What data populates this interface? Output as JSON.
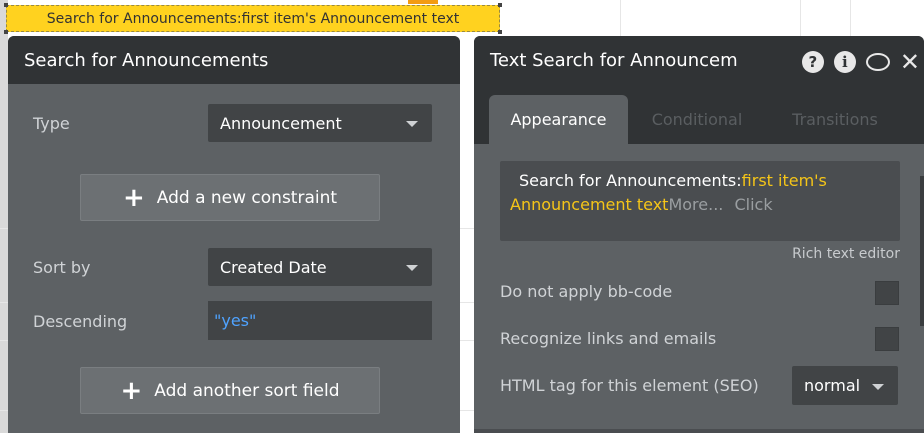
{
  "canvas": {
    "selected_text": "Search for Announcements:first item's Announcement text"
  },
  "left_panel": {
    "title": "Search for Announcements",
    "type_label": "Type",
    "type_value": "Announcement",
    "add_constraint_label": "Add a new constraint",
    "sort_by_label": "Sort by",
    "sort_by_value": "Created Date",
    "descending_label": "Descending",
    "descending_value": "\"yes\"",
    "add_sort_label": "Add another sort field"
  },
  "right_panel": {
    "title": "Text Search for Announcem",
    "tabs": [
      {
        "label": "Appearance",
        "active": true
      },
      {
        "label": "Conditional",
        "active": false
      },
      {
        "label": "Transitions",
        "active": false
      }
    ],
    "text_prefix": "Search for Announcements:",
    "text_dynamic_a": "first item's",
    "text_dynamic_b": "Announcement text",
    "text_more": "More...",
    "text_click": "Click",
    "rich_text_label": "Rich text editor",
    "bbcode_label": "Do not apply bb-code",
    "links_label": "Recognize links and emails",
    "html_tag_label": "HTML tag for this element (SEO)",
    "html_tag_value": "normal"
  },
  "colors": {
    "accent_yellow": "#ffd21f",
    "dynamic_text": "#f5c518",
    "link_blue": "#4fa3ff",
    "panel_bg": "#5d6164",
    "header_bg": "#303335"
  }
}
